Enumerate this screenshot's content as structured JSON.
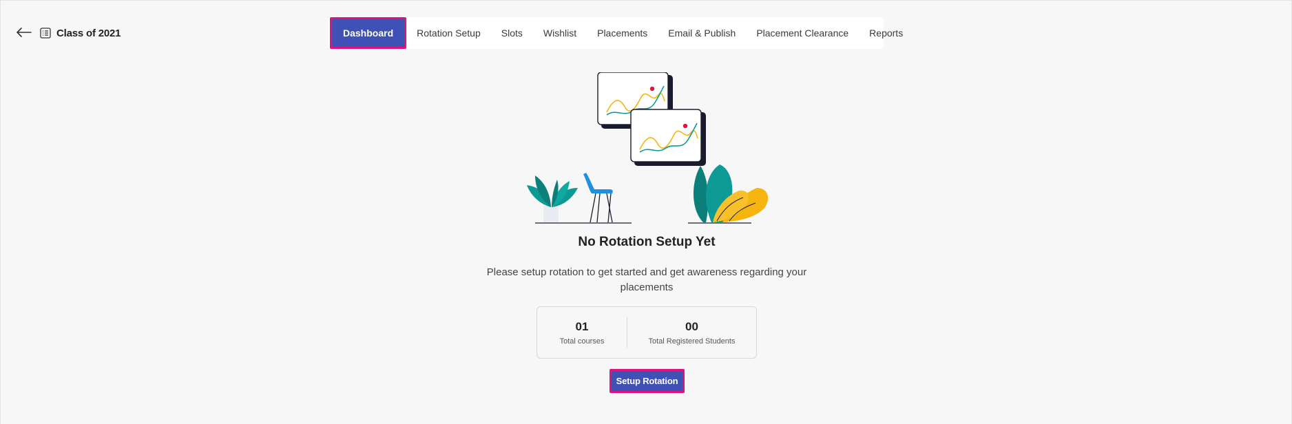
{
  "header": {
    "title": "Class of 2021",
    "back_icon": "arrow-left-icon",
    "title_icon": "list-icon"
  },
  "nav": {
    "tabs": [
      {
        "label": "Dashboard",
        "active": true
      },
      {
        "label": "Rotation Setup"
      },
      {
        "label": "Slots"
      },
      {
        "label": "Wishlist"
      },
      {
        "label": "Placements"
      },
      {
        "label": "Email & Publish"
      },
      {
        "label": "Placement Clearance"
      },
      {
        "label": "Reports"
      }
    ]
  },
  "empty_state": {
    "title": "No Rotation Setup Yet",
    "description": "Please setup rotation to get started and get awareness regarding your placements"
  },
  "stats": [
    {
      "value": "01",
      "label": "Total courses"
    },
    {
      "value": "00",
      "label": "Total Registered Students"
    }
  ],
  "cta": {
    "label": "Setup Rotation"
  },
  "colors": {
    "primary": "#3f51b5",
    "highlight_border": "#e0137c",
    "teal": "#0e9a94",
    "yellow": "#f6b40e",
    "blue": "#1f8fe0"
  }
}
